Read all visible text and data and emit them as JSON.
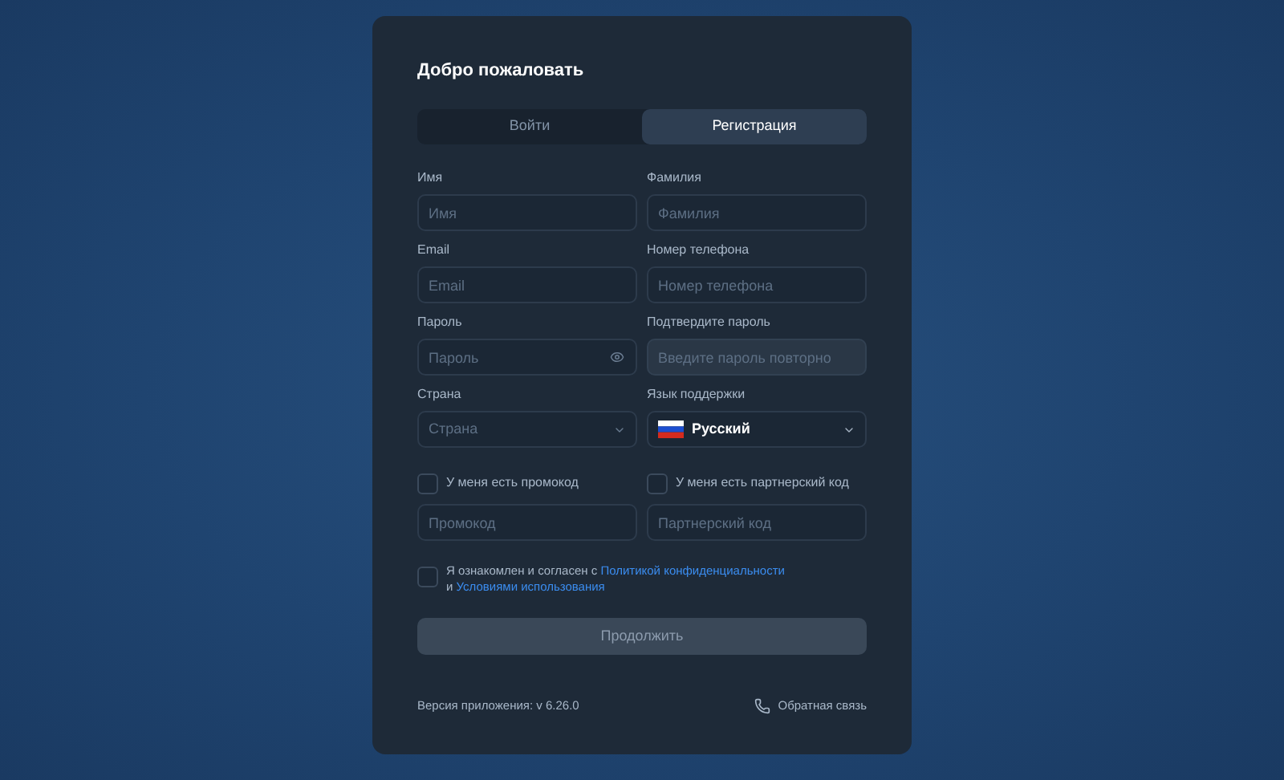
{
  "title": "Добро пожаловать",
  "tabs": [
    {
      "label": "Войти",
      "selected": false
    },
    {
      "label": "Регистрация",
      "selected": true
    }
  ],
  "fields": [
    {
      "kind": "text",
      "label": "Имя",
      "placeholder": "Имя",
      "disabled": false
    },
    {
      "kind": "text",
      "label": "Фамилия",
      "placeholder": "Фамилия",
      "disabled": false
    },
    {
      "kind": "text",
      "label": "Email",
      "placeholder": "Email",
      "disabled": false
    },
    {
      "kind": "text",
      "label": "Номер телефона",
      "placeholder": "Номер телефона",
      "disabled": false
    },
    {
      "kind": "password",
      "label": "Пароль",
      "placeholder": "Пароль",
      "disabled": false
    },
    {
      "kind": "text",
      "label": "Подтвердите пароль",
      "placeholder": "Введите пароль повторно",
      "disabled": true
    },
    {
      "kind": "select",
      "label": "Страна",
      "placeholder": "Страна",
      "disabled": false
    },
    {
      "kind": "language",
      "label": "Язык поддержки",
      "value": "Русский",
      "disabled": false
    }
  ],
  "codes": [
    {
      "label": "У меня есть промокод",
      "checked": false,
      "placeholder": "Промокод"
    },
    {
      "label": "У меня есть партнерский код",
      "checked": false,
      "placeholder": "Партнерский код"
    }
  ],
  "agreement": {
    "checked": false,
    "text_1": "Я ознакомлен и согласен с ",
    "link_1": "Политикой конфиденциальности",
    "text_2": "и ",
    "link_2": "Условиями использования"
  },
  "submit": {
    "label": "Продолжить",
    "disabled": true
  },
  "footer": {
    "version": "Версия приложения: v 6.26.0",
    "feedback": "Обратная связь"
  }
}
